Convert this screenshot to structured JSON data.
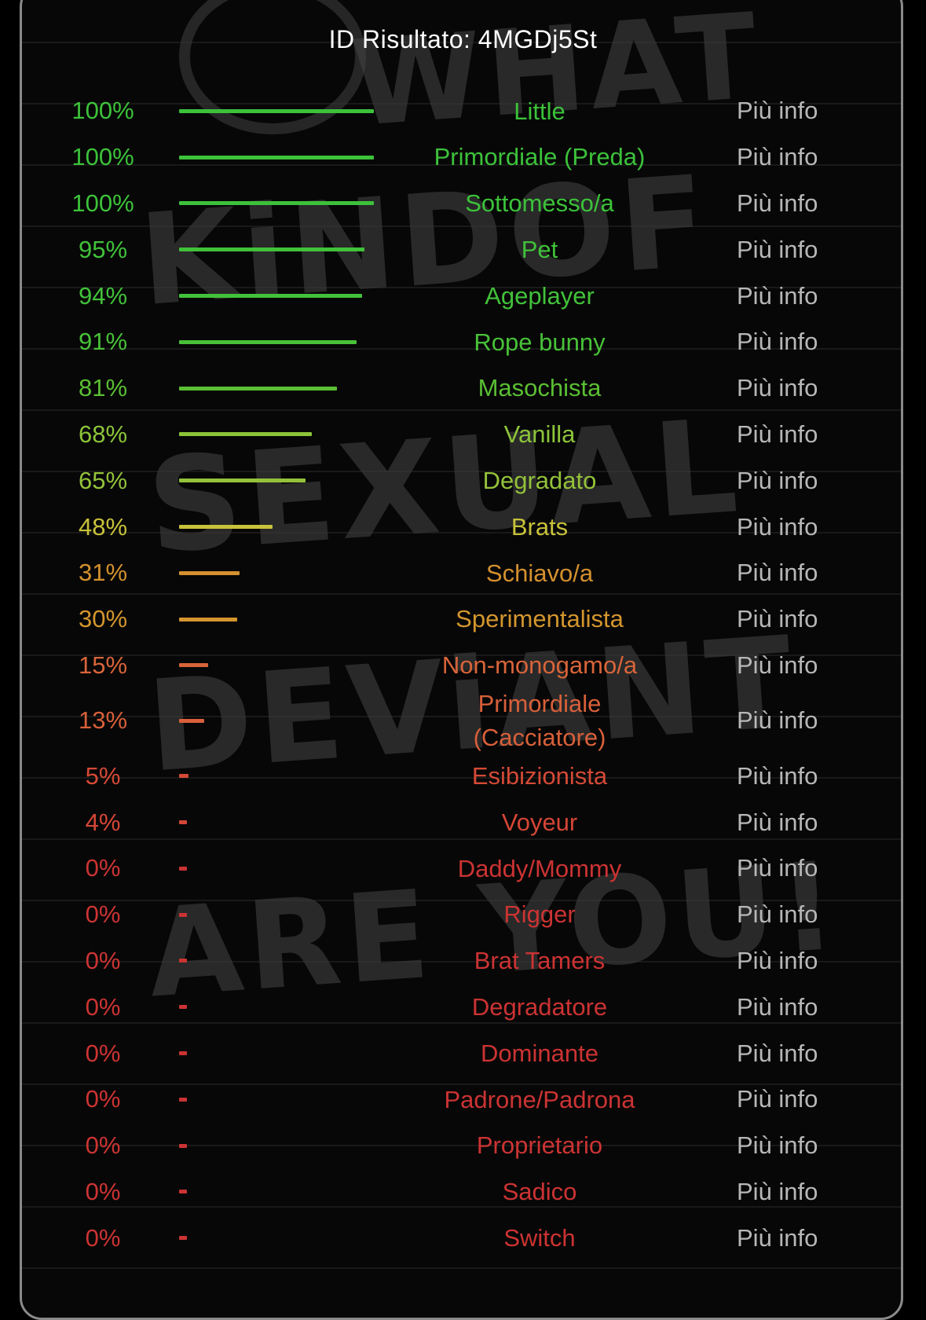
{
  "header": {
    "title": "ID Risultato: 4MGDj5St"
  },
  "background": {
    "graffiti_lines": [
      "WHAT",
      "KiNDOF",
      "SEXUAL",
      "DEViANT",
      "ARE YOU!"
    ]
  },
  "more_info_label": "Più info",
  "colors": {
    "more_info": "#b7b7b7",
    "title": "#ffffff"
  },
  "results": [
    {
      "percent": 100,
      "percent_label": "100%",
      "label": "Little",
      "color": "#3cc23a"
    },
    {
      "percent": 100,
      "percent_label": "100%",
      "label": "Primordiale (Preda)",
      "color": "#3cc23a"
    },
    {
      "percent": 100,
      "percent_label": "100%",
      "label": "Sottomesso/a",
      "color": "#3cc23a"
    },
    {
      "percent": 95,
      "percent_label": "95%",
      "label": "Pet",
      "color": "#40c23a"
    },
    {
      "percent": 94,
      "percent_label": "94%",
      "label": "Ageplayer",
      "color": "#42c23a"
    },
    {
      "percent": 91,
      "percent_label": "91%",
      "label": "Rope bunny",
      "color": "#48c138"
    },
    {
      "percent": 81,
      "percent_label": "81%",
      "label": "Masochista",
      "color": "#5abf33"
    },
    {
      "percent": 68,
      "percent_label": "68%",
      "label": "Vanilla",
      "color": "#8cc43a"
    },
    {
      "percent": 65,
      "percent_label": "65%",
      "label": "Degradato",
      "color": "#93c23a"
    },
    {
      "percent": 48,
      "percent_label": "48%",
      "label": "Brats",
      "color": "#c8c23a"
    },
    {
      "percent": 31,
      "percent_label": "31%",
      "label": "Schiavo/a",
      "color": "#d4912e"
    },
    {
      "percent": 30,
      "percent_label": "30%",
      "label": "Sperimentalista",
      "color": "#d4962e"
    },
    {
      "percent": 15,
      "percent_label": "15%",
      "label": "Non-monogamo/a",
      "color": "#d8643a"
    },
    {
      "percent": 13,
      "percent_label": "13%",
      "label": "Primordiale (Cacciatore)",
      "color": "#d8603a"
    },
    {
      "percent": 5,
      "percent_label": "5%",
      "label": "Esibizionista",
      "color": "#d44a36"
    },
    {
      "percent": 4,
      "percent_label": "4%",
      "label": "Voyeur",
      "color": "#d44636"
    },
    {
      "percent": 0,
      "percent_label": "0%",
      "label": "Daddy/Mommy",
      "color": "#cc3333"
    },
    {
      "percent": 0,
      "percent_label": "0%",
      "label": "Rigger",
      "color": "#cc3333"
    },
    {
      "percent": 0,
      "percent_label": "0%",
      "label": "Brat Tamers",
      "color": "#cc3333"
    },
    {
      "percent": 0,
      "percent_label": "0%",
      "label": "Degradatore",
      "color": "#cc3333"
    },
    {
      "percent": 0,
      "percent_label": "0%",
      "label": "Dominante",
      "color": "#cc3333"
    },
    {
      "percent": 0,
      "percent_label": "0%",
      "label": "Padrone/Padrona",
      "color": "#cc3333"
    },
    {
      "percent": 0,
      "percent_label": "0%",
      "label": "Proprietario",
      "color": "#cc3333"
    },
    {
      "percent": 0,
      "percent_label": "0%",
      "label": "Sadico",
      "color": "#cc3333"
    },
    {
      "percent": 0,
      "percent_label": "0%",
      "label": "Switch",
      "color": "#cc3333"
    }
  ]
}
